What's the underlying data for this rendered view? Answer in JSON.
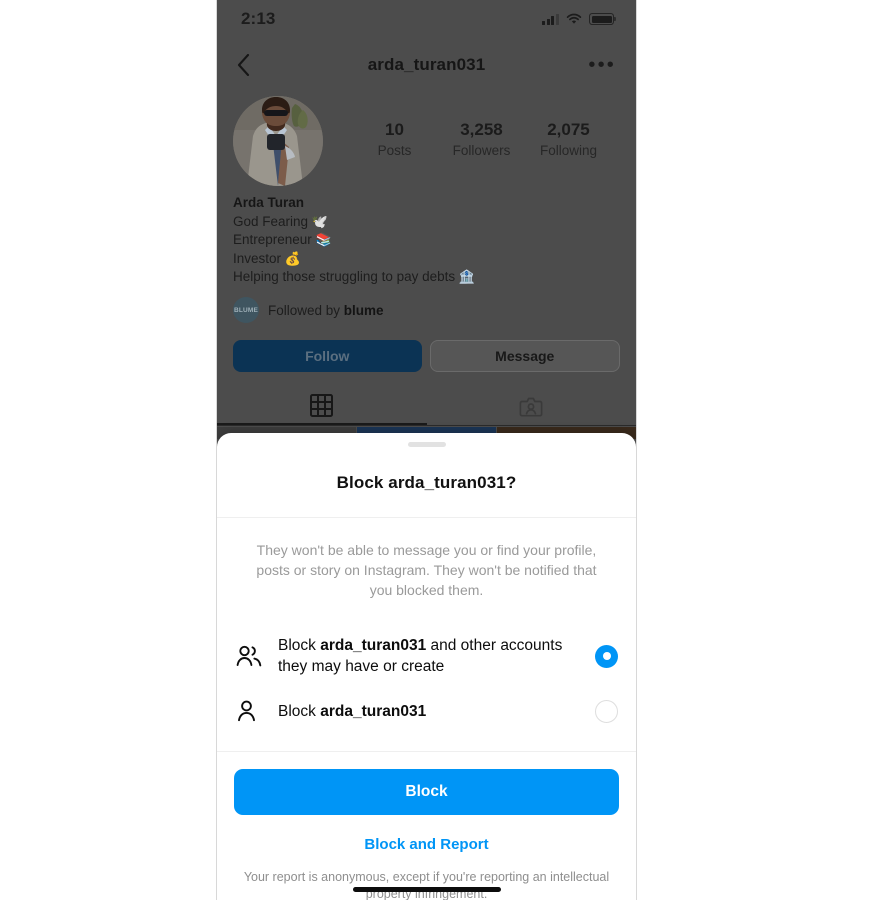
{
  "status_bar": {
    "time": "2:13",
    "signal_icon": "cellular-bars-icon",
    "wifi_icon": "wifi-icon",
    "battery_icon": "battery-icon"
  },
  "nav": {
    "back_icon": "chevron-left-icon",
    "title": "arda_turan031",
    "more_icon": "ellipsis-icon",
    "more_glyph": "•••"
  },
  "profile": {
    "avatar_name": "profile-avatar",
    "display_name": "Arda Turan",
    "stats": [
      {
        "num": "10",
        "label": "Posts"
      },
      {
        "num": "3,258",
        "label": "Followers"
      },
      {
        "num": "2,075",
        "label": "Following"
      }
    ],
    "bio_lines": [
      {
        "text": "God Fearing ",
        "emoji": "🕊️"
      },
      {
        "text": "Entrepreneur ",
        "emoji": "📚"
      },
      {
        "text": "Investor ",
        "emoji": "💰"
      },
      {
        "text": "Helping those struggling to pay debts ",
        "emoji": "🏦"
      }
    ],
    "followed_by": {
      "avatar_text": "BLUME",
      "prefix": "Followed by ",
      "name": "blume"
    },
    "follow_label": "Follow",
    "message_label": "Message",
    "tabs": [
      {
        "name": "grid-tab",
        "icon": "grid-icon",
        "active": true
      },
      {
        "name": "tagged-tab",
        "icon": "tagged-photos-icon",
        "active": false
      }
    ],
    "post_thumbnail_colors": [
      "#3d3d3d",
      "#1b3556",
      "#3a2a1c"
    ]
  },
  "sheet": {
    "grabber_name": "sheet-drag-handle",
    "title": "Block arda_turan031?",
    "description": "They won't be able to message you or find your profile, posts or story on Instagram. They won't be notified that you blocked them.",
    "options": [
      {
        "icon": "people-group-icon",
        "prefix": "Block ",
        "bold": "arda_turan031",
        "suffix": " and other accounts they may have or create",
        "selected": true
      },
      {
        "icon": "person-icon",
        "prefix": "Block ",
        "bold": "arda_turan031",
        "suffix": "",
        "selected": false
      }
    ],
    "block_button_label": "Block",
    "block_report_label": "Block and Report",
    "legal": "Your report is anonymous, except if you're reporting an intellectual property infringement."
  },
  "colors": {
    "accent_blue": "#0095f6",
    "overlay_grey": "#4c4c4c",
    "follow_dimmed": "#0b3354"
  }
}
